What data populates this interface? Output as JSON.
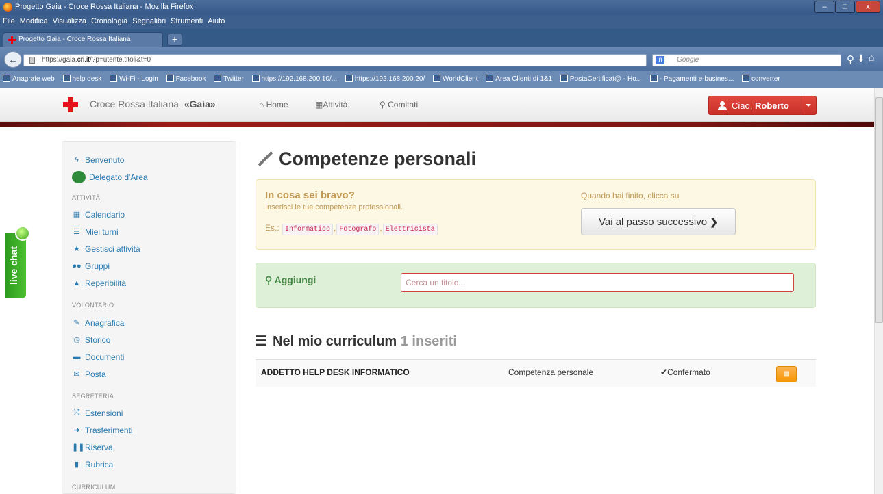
{
  "window": {
    "title": "Progetto Gaia - Croce Rossa Italiana - Mozilla Firefox",
    "tab_title": "Progetto Gaia - Croce Rossa Italiana",
    "new_tab": "+",
    "minimize": "–",
    "maximize": "□",
    "close": "x"
  },
  "menu": [
    "File",
    "Modifica",
    "Visualizza",
    "Cronologia",
    "Segnalibri",
    "Strumenti",
    "Aiuto"
  ],
  "address_bar": {
    "prefix": "https://gaia.",
    "domain": "cri.it",
    "suffix": "/?p=utente.titoli&t=0",
    "search_placeholder": "Google"
  },
  "bookmarks": [
    "Anagrafe web",
    "help desk",
    "Wi-Fi - Login",
    "Facebook",
    "Twitter",
    "https://192.168.200.10/...",
    "https://192.168.200.20/",
    "WorldClient",
    "Area Clienti di 1&1",
    "PostaCertificat@ - Ho...",
    "- Pagamenti e-busines...",
    "converter"
  ],
  "gaia_nav": {
    "brand_name": "Croce Rossa Italiana",
    "brand_tag": "«Gaia»",
    "links": {
      "home": "Home",
      "attivita": "Attività",
      "comitati": "Comitati"
    },
    "user_greeting": "Ciao,",
    "user_name": "Roberto"
  },
  "sidebar": {
    "benvenuto": "Benvenuto",
    "delegato": "Delegato d'Area",
    "sections": {
      "attivita": "ATTIVITÀ",
      "volontario": "VOLONTARIO",
      "segreteria": "SEGRETERIA",
      "curriculum": "CURRICULUM"
    },
    "attivita_items": [
      "Calendario",
      "Miei turni",
      "Gestisci attività",
      "Gruppi",
      "Reperibilità"
    ],
    "volontario_items": [
      "Anagrafica",
      "Storico",
      "Documenti",
      "Posta"
    ],
    "segreteria_items": [
      "Estensioni",
      "Trasferimenti",
      "Riserva",
      "Rubrica"
    ]
  },
  "live_chat": "live chat",
  "main": {
    "title": "Competenze personali",
    "info": {
      "question": "In cosa sei bravo?",
      "subtitle": "Inserisci le tue competenze professionali.",
      "example_prefix": "Es.:",
      "examples": [
        "Informatico",
        "Fotografo",
        "Elettricista"
      ],
      "done_hint": "Quando hai finito, clicca su",
      "next_button": "Vai al passo successivo"
    },
    "add": {
      "label": "Aggiungi",
      "placeholder": "Cerca un titolo..."
    },
    "curriculum": {
      "title": "Nel mio curriculum",
      "count": "1 inseriti",
      "rows": [
        {
          "name": "ADDETTO HELP DESK INFORMATICO",
          "type": "Competenza personale",
          "status": "Confermato"
        }
      ]
    }
  }
}
